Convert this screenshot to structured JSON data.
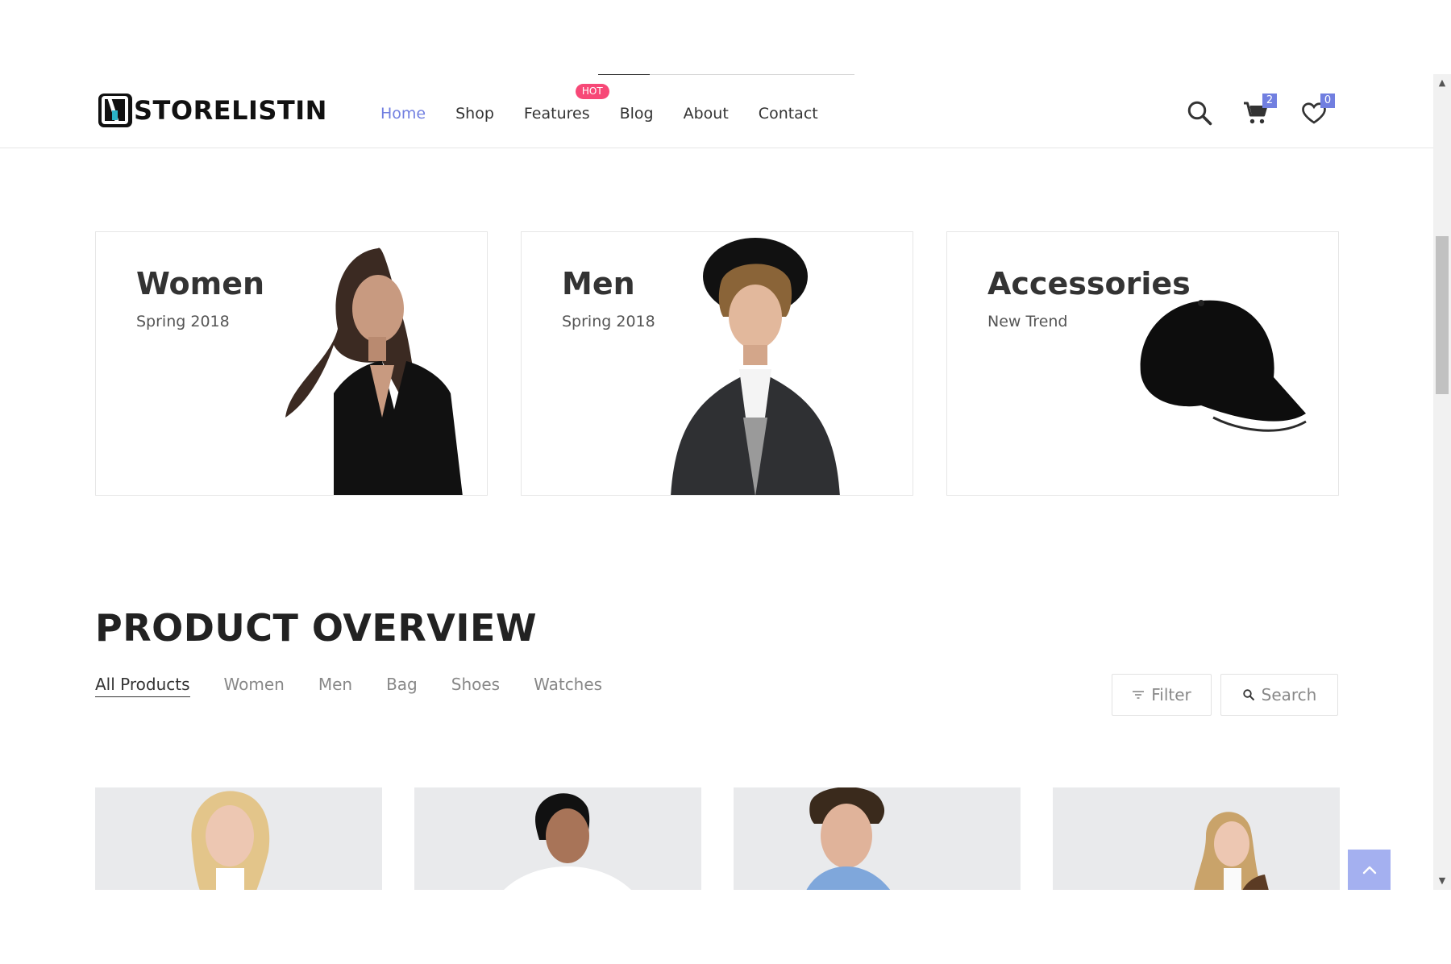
{
  "header": {
    "logo_text": "STORELISTIN",
    "nav": [
      {
        "label": "Home"
      },
      {
        "label": "Shop"
      },
      {
        "label": "Features",
        "badge": "HOT"
      },
      {
        "label": "Blog"
      },
      {
        "label": "About"
      },
      {
        "label": "Contact"
      }
    ],
    "cart_count": "2",
    "wishlist_count": "0"
  },
  "banners": [
    {
      "title": "Women",
      "subtitle": "Spring 2018"
    },
    {
      "title": "Men",
      "subtitle": "Spring 2018"
    },
    {
      "title": "Accessories",
      "subtitle": "New Trend"
    }
  ],
  "overview": {
    "title": "PRODUCT OVERVIEW",
    "filters": [
      "All Products",
      "Women",
      "Men",
      "Bag",
      "Shoes",
      "Watches"
    ],
    "filter_button": "Filter",
    "search_button": "Search"
  },
  "colors": {
    "accent": "#717fe0",
    "hot_badge": "#f74877",
    "back_to_top": "#a4b0f0"
  },
  "icons": [
    "search-icon",
    "cart-icon",
    "heart-icon",
    "filter-icon",
    "search-small-icon",
    "chevron-up-icon"
  ]
}
